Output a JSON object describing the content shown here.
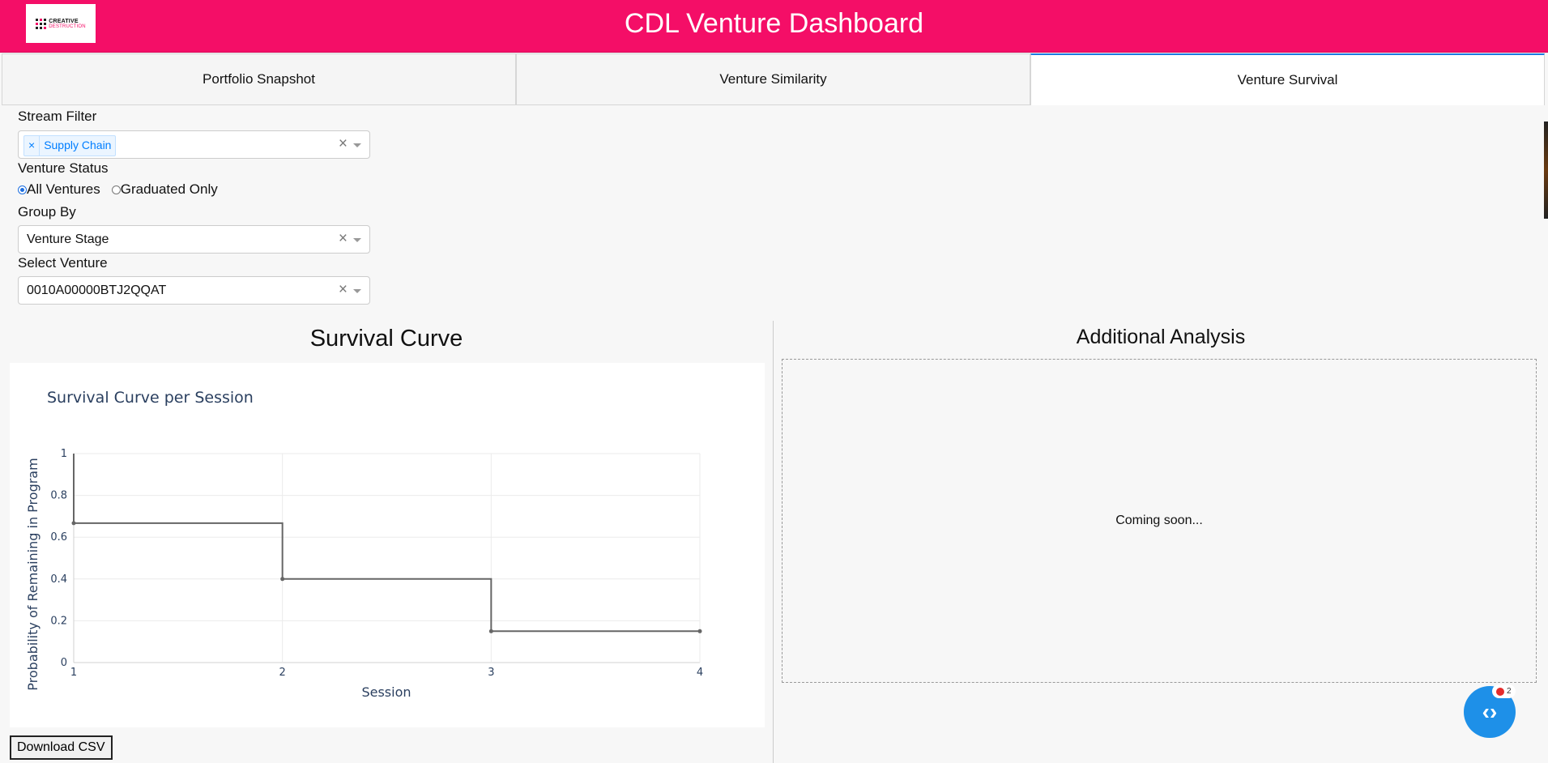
{
  "header": {
    "title": "CDL Venture Dashboard",
    "logo_text_top": "CREATIVE",
    "logo_text_bottom": "DESTRUCTION",
    "background_color": "#f40e67"
  },
  "tabs": [
    {
      "label": "Portfolio Snapshot",
      "active": false
    },
    {
      "label": "Venture Similarity",
      "active": false
    },
    {
      "label": "Venture Survival",
      "active": true
    }
  ],
  "filters": {
    "stream_filter": {
      "label": "Stream Filter",
      "chips": [
        "Supply Chain"
      ],
      "remove_glyph": "×",
      "clear_glyph": "×"
    },
    "venture_status": {
      "label": "Venture Status",
      "options": [
        "All Ventures",
        "Graduated Only"
      ],
      "selected": "All Ventures"
    },
    "group_by": {
      "label": "Group By",
      "value": "Venture Stage",
      "clear_glyph": "×"
    },
    "select_venture": {
      "label": "Select Venture",
      "value": "0010A00000BTJ2QQAT",
      "clear_glyph": "×"
    }
  },
  "survival_section": {
    "heading": "Survival Curve"
  },
  "chart_data": {
    "type": "line",
    "line_shape": "step",
    "title": "Survival Curve per Session",
    "xlabel": "Session",
    "ylabel": "Probability of Remaining in Program",
    "xlim": [
      1,
      4
    ],
    "ylim": [
      0,
      1
    ],
    "x_ticks": [
      1,
      2,
      3,
      4
    ],
    "y_ticks": [
      0,
      0.2,
      0.4,
      0.6,
      0.8,
      1
    ],
    "y_tick_labels": [
      "0",
      "0.2",
      "0.4",
      "0.6",
      "0.8",
      "1"
    ],
    "grid": true,
    "series": [
      {
        "x": [
          1,
          2,
          3,
          4
        ],
        "y": [
          0.667,
          0.4,
          0.15,
          0.15
        ],
        "color": "#666666"
      }
    ]
  },
  "additional_analysis": {
    "heading": "Additional Analysis",
    "message": "Coming soon..."
  },
  "download_button": {
    "label": "Download CSV"
  },
  "debug_fab": {
    "icon": "code-brackets-icon",
    "badge_count": "2"
  }
}
